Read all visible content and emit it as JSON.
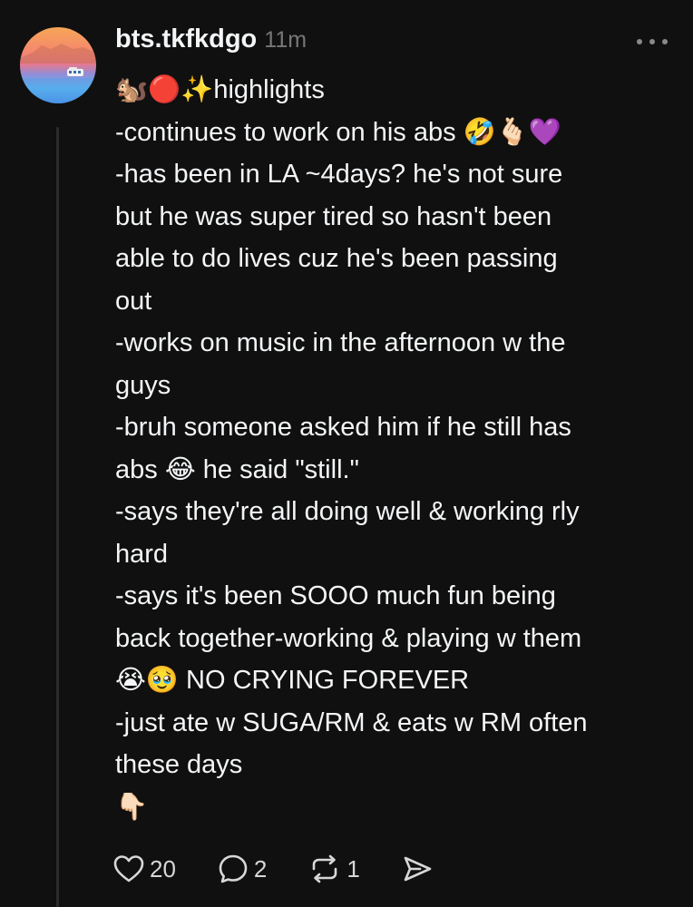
{
  "post": {
    "username": "bts.tkfkdgo",
    "timestamp": "11m",
    "lines": [
      "🐿️🔴✨highlights",
      "-continues to work on his abs 🤣🫰🏻💜",
      "-has been in LA ~4days? he's not sure",
      "but he was super tired so hasn't been",
      "able to do lives cuz he's been passing",
      "out",
      "-works on music in the afternoon w the",
      "guys",
      "-bruh someone asked him if he still has",
      "abs 😂 he said \"still.\"",
      "-says they're all doing well & working rly",
      "hard",
      "-says it's been SOOO much fun being",
      "back together-working & playing w them",
      "😭🥹 NO CRYING FOREVER",
      "-just ate w SUGA/RM & eats w RM often",
      "these days",
      "👇🏻"
    ]
  },
  "actions": {
    "like_count": "20",
    "reply_count": "2",
    "repost_count": "1"
  },
  "icons": {
    "like": "heart-icon",
    "reply": "comment-bubble-icon",
    "repost": "repost-icon",
    "share": "send-icon",
    "more": "more-options-icon"
  },
  "colors": {
    "background": "#101010",
    "text": "#f3f5f7",
    "muted": "#777777",
    "thread_line": "#2c2c2c"
  }
}
